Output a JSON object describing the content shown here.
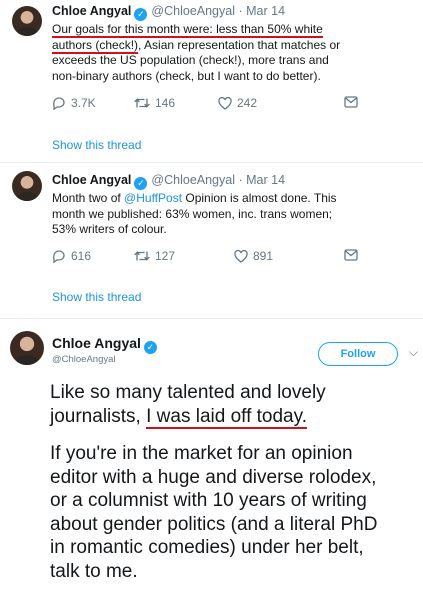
{
  "tweets": [
    {
      "name": "Chloe Angyal",
      "handle": "@ChloeAngyal",
      "date": "· Mar 14",
      "text_underlined_1": "Our goals for this month were: less than 50% white",
      "text_underlined_2": "authors (check!)",
      "text_rest_2": ", Asian representation that matches or",
      "text_line_3": "exceeds the US population (check!), more trans and",
      "text_line_4": "non-binary authors (check, but I want to do better).",
      "replies": "3.7K",
      "retweets": "146",
      "likes": "242",
      "thread_link": "Show this thread"
    },
    {
      "name": "Chloe Angyal",
      "handle": "@ChloeAngyal",
      "date": "· Mar 14",
      "text_before_mention": "Month two of ",
      "mention": "@HuffPost",
      "text_after_mention": " Opinion is almost done. This",
      "text_line_2": "month we published: 63% women, inc. trans women;",
      "text_line_3": "53% writers of colour.",
      "replies": "616",
      "retweets": "127",
      "likes": "891",
      "thread_link": "Show this thread"
    },
    {
      "name": "Chloe Angyal",
      "handle": "@ChloeAngyal",
      "follow_label": "Follow",
      "para1_line1": "Like so many talented and lovely",
      "para1_line2_prefix": "journalists, ",
      "para1_line2_underlined": "I was laid off today.",
      "para2_line1": "If you're in the market for an opinion",
      "para2_line2": "editor with a huge and diverse rolodex,",
      "para2_line3": "or a columnist with 10 years of writing",
      "para2_line4": "about gender politics (and a literal PhD",
      "para2_line5": "in romantic comedies) under her belt,",
      "para2_line6": "talk to me."
    }
  ],
  "icons": {
    "verified": "verified-badge-icon",
    "reply": "reply-icon",
    "retweet": "retweet-icon",
    "like": "heart-icon",
    "message": "direct-message-icon",
    "more": "chevron-down-icon"
  },
  "colors": {
    "accent": "#1da1f2",
    "link": "#1b95e0",
    "muted": "#657786",
    "annotation_red": "#d0111b"
  }
}
